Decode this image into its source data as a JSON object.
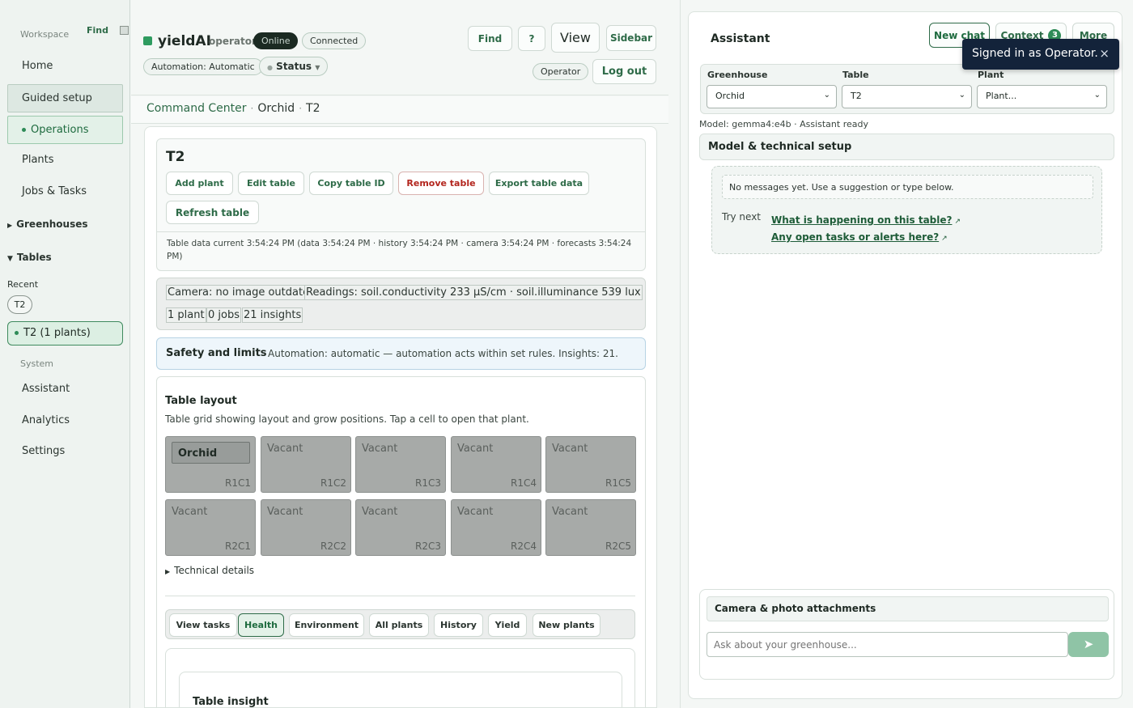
{
  "sidebar": {
    "workspace_label": "Workspace",
    "find_label": "Find",
    "nav": {
      "home": "Home",
      "guided_setup": "Guided setup",
      "operations": "Operations",
      "plants": "Plants",
      "jobs_tasks": "Jobs & Tasks"
    },
    "greenhouses_label": "Greenhouses",
    "tables_label": "Tables",
    "recent_label": "Recent",
    "recent_chip": "T2",
    "current_table": "T2 (1 plants)",
    "system_label": "System",
    "system_nav": {
      "assistant": "Assistant",
      "analytics": "Analytics",
      "settings": "Settings"
    }
  },
  "header": {
    "app_name": "yieldAI",
    "role": "operator",
    "online": "Online",
    "connected": "Connected",
    "automation": "Automation: Automatic",
    "status": "Status",
    "buttons": {
      "find": "Find",
      "help": "?",
      "view": "View",
      "sidebar": "Sidebar",
      "logout": "Log out"
    },
    "operator_badge": "Operator"
  },
  "breadcrumb": {
    "root": "Command Center",
    "greenhouse": "Orchid",
    "table": "T2"
  },
  "table_card": {
    "title": "T2",
    "actions": {
      "add_plant": "Add plant",
      "edit_table": "Edit table",
      "copy_id": "Copy table ID",
      "remove": "Remove table",
      "export": "Export table data",
      "refresh": "Refresh table"
    },
    "freshness": "Table data current 3:54:24 PM (data 3:54:24 PM · history 3:54:24 PM · camera 3:54:24 PM · forecasts 3:54:24 PM)"
  },
  "status_strip": {
    "camera": "Camera: no image outdated",
    "readings": "Readings: soil.conductivity 233 µS/cm · soil.illuminance 539 lux",
    "plants": "1 plant",
    "jobs": "0 jobs",
    "insights": "21 insights"
  },
  "safety": {
    "title": "Safety and limits",
    "text": "Automation: automatic — automation acts within set rules. Insights: 21."
  },
  "layout": {
    "title": "Table layout",
    "subtitle": "Table grid showing layout and grow positions. Tap a cell to open that plant.",
    "cells": [
      {
        "name": "Orchid",
        "id": "R1C1",
        "occupied": true
      },
      {
        "name": "Vacant",
        "id": "R1C2"
      },
      {
        "name": "Vacant",
        "id": "R1C3"
      },
      {
        "name": "Vacant",
        "id": "R1C4"
      },
      {
        "name": "Vacant",
        "id": "R1C5"
      },
      {
        "name": "Vacant",
        "id": "R2C1"
      },
      {
        "name": "Vacant",
        "id": "R2C2"
      },
      {
        "name": "Vacant",
        "id": "R2C3"
      },
      {
        "name": "Vacant",
        "id": "R2C4"
      },
      {
        "name": "Vacant",
        "id": "R2C5"
      }
    ],
    "technical_details": "Technical details"
  },
  "tabs": {
    "view_tasks": "View tasks",
    "health": "Health",
    "environment": "Environment",
    "all_plants": "All plants",
    "history": "History",
    "yield": "Yield",
    "new_plants": "New plants"
  },
  "insight": {
    "title": "Table insight"
  },
  "assistant": {
    "title": "Assistant",
    "new_chat": "New chat",
    "context": "Context",
    "context_count": "3",
    "more": "More",
    "toast": "Signed in as Operator.",
    "toast_close": "×",
    "labels": {
      "greenhouse": "Greenhouse",
      "table": "Table",
      "plant": "Plant"
    },
    "selects": {
      "greenhouse": "Orchid",
      "table": "T2",
      "plant": "Plant..."
    },
    "model_status": "Model: gemma4:e4b · Assistant ready",
    "setup": "Model & technical setup",
    "empty_msg": "No messages yet. Use a suggestion or type below.",
    "try_next": "Try next",
    "suggestions": {
      "s1": "What is happening on this table?",
      "s2": "Any open tasks or alerts here?"
    },
    "attachments": "Camera & photo attachments",
    "input_placeholder": "Ask about your greenhouse..."
  },
  "colors": {
    "accent": "#2e6b48",
    "online_bg": "#1b2a22",
    "danger": "#b3261e",
    "send": "#8fc4a6"
  }
}
